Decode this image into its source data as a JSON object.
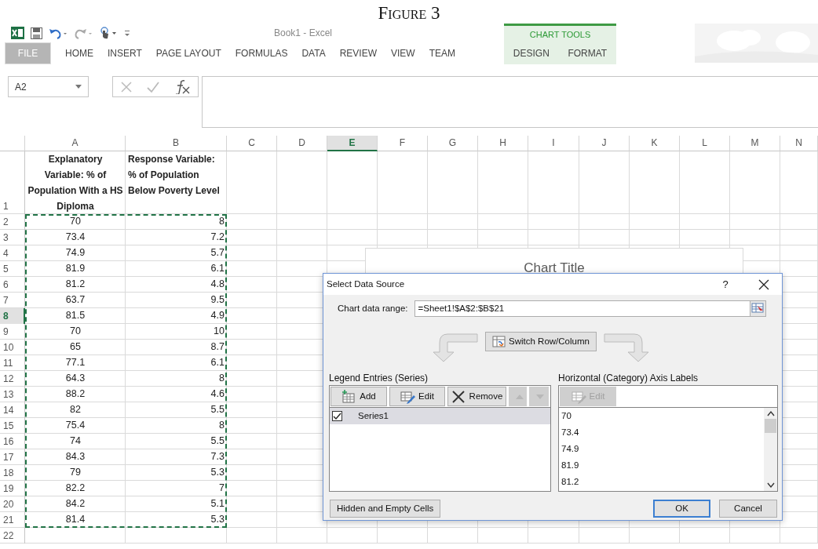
{
  "caption": "Figure 3",
  "window": {
    "title": "Book1 - Excel"
  },
  "ribbon": {
    "tabs": [
      {
        "label": "FILE",
        "kind": "file"
      },
      {
        "label": "HOME",
        "kind": "normal"
      },
      {
        "label": "INSERT",
        "kind": "normal"
      },
      {
        "label": "PAGE LAYOUT",
        "kind": "normal"
      },
      {
        "label": "FORMULAS",
        "kind": "normal"
      },
      {
        "label": "DATA",
        "kind": "normal"
      },
      {
        "label": "REVIEW",
        "kind": "normal"
      },
      {
        "label": "VIEW",
        "kind": "normal"
      },
      {
        "label": "TEAM",
        "kind": "normal"
      }
    ],
    "contextual_group": {
      "label": "CHART TOOLS",
      "tabs": [
        {
          "label": "DESIGN"
        },
        {
          "label": "FORMAT"
        }
      ]
    }
  },
  "formula_bar": {
    "name_box": "A2"
  },
  "sheet": {
    "columns": [
      {
        "label": "A",
        "selected": false
      },
      {
        "label": "B",
        "selected": false
      },
      {
        "label": "C",
        "selected": false
      },
      {
        "label": "D",
        "selected": false
      },
      {
        "label": "E",
        "selected": true
      },
      {
        "label": "F",
        "selected": false
      },
      {
        "label": "G",
        "selected": false
      },
      {
        "label": "H",
        "selected": false
      },
      {
        "label": "I",
        "selected": false
      },
      {
        "label": "J",
        "selected": false
      },
      {
        "label": "K",
        "selected": false
      },
      {
        "label": "L",
        "selected": false
      },
      {
        "label": "M",
        "selected": false
      },
      {
        "label": "N",
        "selected": false
      }
    ],
    "rows": [
      {
        "number": "1",
        "selected": false,
        "cells": [
          "Explanatory Variable: % of Population With a HS Diploma",
          "Response Variable: % of Population Below Poverty Level"
        ]
      },
      {
        "number": "2",
        "selected": false,
        "cells": [
          "70",
          "8"
        ]
      },
      {
        "number": "3",
        "selected": false,
        "cells": [
          "73.4",
          "7.2"
        ]
      },
      {
        "number": "4",
        "selected": false,
        "cells": [
          "74.9",
          "5.7"
        ]
      },
      {
        "number": "5",
        "selected": false,
        "cells": [
          "81.9",
          "6.1"
        ]
      },
      {
        "number": "6",
        "selected": false,
        "cells": [
          "81.2",
          "4.8"
        ]
      },
      {
        "number": "7",
        "selected": false,
        "cells": [
          "63.7",
          "9.5"
        ]
      },
      {
        "number": "8",
        "selected": true,
        "cells": [
          "81.5",
          "4.9"
        ]
      },
      {
        "number": "9",
        "selected": false,
        "cells": [
          "70",
          "10"
        ]
      },
      {
        "number": "10",
        "selected": false,
        "cells": [
          "65",
          "8.7"
        ]
      },
      {
        "number": "11",
        "selected": false,
        "cells": [
          "77.1",
          "6.1"
        ]
      },
      {
        "number": "12",
        "selected": false,
        "cells": [
          "64.3",
          "8"
        ]
      },
      {
        "number": "13",
        "selected": false,
        "cells": [
          "88.2",
          "4.6"
        ]
      },
      {
        "number": "14",
        "selected": false,
        "cells": [
          "82",
          "5.5"
        ]
      },
      {
        "number": "15",
        "selected": false,
        "cells": [
          "75.4",
          "8"
        ]
      },
      {
        "number": "16",
        "selected": false,
        "cells": [
          "74",
          "5.5"
        ]
      },
      {
        "number": "17",
        "selected": false,
        "cells": [
          "84.3",
          "7.3"
        ]
      },
      {
        "number": "18",
        "selected": false,
        "cells": [
          "79",
          "5.3"
        ]
      },
      {
        "number": "19",
        "selected": false,
        "cells": [
          "82.2",
          "7"
        ]
      },
      {
        "number": "20",
        "selected": false,
        "cells": [
          "84.2",
          "5.1"
        ]
      },
      {
        "number": "21",
        "selected": false,
        "cells": [
          "81.4",
          "5.3"
        ]
      },
      {
        "number": "22",
        "selected": false
      }
    ]
  },
  "chart": {
    "title": "Chart Title"
  },
  "dialog": {
    "title": "Select Data Source",
    "help": "?",
    "range_label": "Chart data range:",
    "range_value": "=Sheet1!$A$2:$B$21",
    "switch_button": "Switch Row/Column",
    "legend": {
      "label": "Legend Entries (Series)",
      "buttons": [
        {
          "label": "Add",
          "kind": "add"
        },
        {
          "label": "Edit",
          "kind": "edit"
        },
        {
          "label": "Remove",
          "kind": "remove"
        }
      ],
      "series": [
        {
          "name": "Series1",
          "checked": true,
          "selected": true
        }
      ]
    },
    "axis": {
      "label": "Horizontal (Category) Axis Labels",
      "edit_button": {
        "label": "Edit",
        "disabled": true
      },
      "items": [
        "70",
        "73.4",
        "74.9",
        "81.9",
        "81.2"
      ]
    },
    "hidden_button": "Hidden and Empty Cells",
    "ok": "OK",
    "cancel": "Cancel"
  }
}
